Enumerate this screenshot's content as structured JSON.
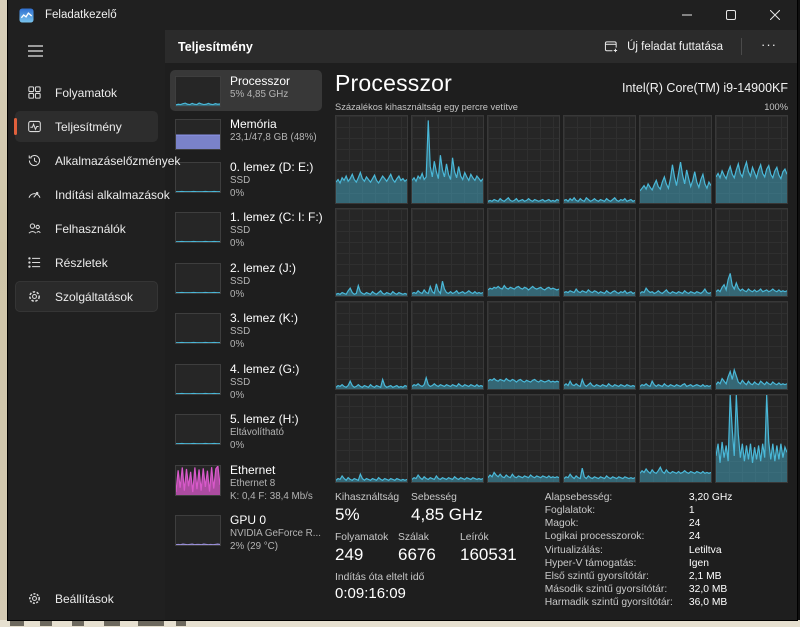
{
  "colors": {
    "accent": "#e0603c",
    "cpu": "#4ab8d8",
    "mem": "#8a93e6",
    "eth": "#d959cb",
    "gpu": "#9a8fd9",
    "desktop_sliver": "#d8cfba",
    "taskbar_sliver": "#e6e0d0"
  },
  "window": {
    "title": "Feladatkezelő"
  },
  "titlebar_icons": {
    "minimize": "minimize-icon",
    "maximize": "maximize-icon",
    "close": "close-icon"
  },
  "header": {
    "title": "Teljesítmény",
    "run_new_task": "Új feladat futtatása",
    "more": "···"
  },
  "sidebar": {
    "items": [
      {
        "label": "Folyamatok",
        "icon": "processes-grid-icon"
      },
      {
        "label": "Teljesítmény",
        "icon": "performance-pulse-icon",
        "selected": true
      },
      {
        "label": "Alkalmazáselőzmények",
        "icon": "app-history-clock-icon"
      },
      {
        "label": "Indítási alkalmazások",
        "icon": "startup-gauge-icon"
      },
      {
        "label": "Felhasználók",
        "icon": "users-icon"
      },
      {
        "label": "Részletek",
        "icon": "details-list-icon"
      },
      {
        "label": "Szolgáltatások",
        "icon": "services-cog-icon"
      }
    ],
    "settings_label": "Beállítások"
  },
  "perf_list": [
    {
      "title": "Processzor",
      "line2": "5% 4,85 GHz"
    },
    {
      "title": "Memória",
      "line2": "23,1/47,8 GB (48%)"
    },
    {
      "title": "0. lemez (D: E:)",
      "line2": "SSD",
      "line3": "0%"
    },
    {
      "title": "1. lemez (C: I: F:)",
      "line2": "SSD",
      "line3": "0%"
    },
    {
      "title": "2. lemez (J:)",
      "line2": "SSD",
      "line3": "0%"
    },
    {
      "title": "3. lemez (K:)",
      "line2": "SSD",
      "line3": "0%"
    },
    {
      "title": "4. lemez (G:)",
      "line2": "SSD",
      "line3": "0%"
    },
    {
      "title": "5. lemez (H:)",
      "line2": "Eltávolítható",
      "line3": "0%"
    },
    {
      "title": "Ethernet",
      "line2": "Ethernet 8",
      "line3": "K: 0,4 F: 38,4 Mb/s"
    },
    {
      "title": "GPU 0",
      "line2": "NVIDIA GeForce R...",
      "line3": "2% (29 °C)"
    }
  ],
  "thumbs": {
    "cpu": [
      4,
      6,
      5,
      8,
      10,
      6,
      5,
      9,
      6,
      5,
      10,
      7,
      5,
      6,
      9,
      6,
      5,
      8,
      6,
      7
    ],
    "mem": [
      48,
      48,
      48,
      48
    ],
    "disk": [
      1,
      1,
      2,
      1,
      1,
      1,
      2,
      1,
      1,
      1,
      2,
      1,
      1,
      2,
      1,
      1
    ],
    "eth": [
      10,
      85,
      25,
      95,
      15,
      90,
      30,
      80,
      10,
      95,
      20,
      88,
      15,
      92,
      28,
      84,
      12,
      96,
      22,
      90,
      100,
      35
    ],
    "gpu": [
      1,
      2,
      1,
      3,
      2,
      1,
      2,
      3,
      1,
      2,
      2,
      1,
      3,
      2,
      1,
      2,
      1,
      2,
      3,
      2
    ]
  },
  "detail": {
    "title": "Processzor",
    "cpu_name": "Intel(R) Core(TM) i9-14900KF",
    "subtitle_left": "Százalékos kihasználtság egy percre vetítve",
    "subtitle_right": "100%",
    "usage_label": "Kihasználtság",
    "usage_value": "5%",
    "speed_label": "Sebesség",
    "speed_value": "4,85 GHz",
    "processes_label": "Folyamatok",
    "processes_value": "249",
    "threads_label": "Szálak",
    "threads_value": "6676",
    "handles_label": "Leírók",
    "handles_value": "160531",
    "uptime_label": "Indítás óta eltelt idő",
    "uptime_value": "0:09:16:09",
    "stats_right": [
      {
        "label": "Alapsebesség:",
        "value": "3,20 GHz"
      },
      {
        "label": "Foglalatok:",
        "value": "1"
      },
      {
        "label": "Magok:",
        "value": "24"
      },
      {
        "label": "Logikai processzorok:",
        "value": "24"
      },
      {
        "label": "Virtualizálás:",
        "value": "Letiltva"
      },
      {
        "label": "Hyper-V támogatás:",
        "value": "Igen"
      },
      {
        "label": "Első szintű gyorsítótár:",
        "value": "2,1 MB"
      },
      {
        "label": "Második szintű gyorsítótár:",
        "value": "32,0 MB"
      },
      {
        "label": "Harmadik szintű gyorsítótár:",
        "value": "36,0 MB"
      }
    ]
  },
  "chart_data": {
    "type": "area",
    "title": "Processzor",
    "subtitle": "Százalékos kihasználtság egy percre vetítve",
    "layout": "24 logical-processor mini graphs, 4 rows × 6 columns, 60 s window",
    "ylim": [
      0,
      100
    ],
    "ymax_label": "100%",
    "grid": true,
    "series": [
      {
        "name": "CPU 0",
        "values": [
          24,
          27,
          23,
          29,
          26,
          31,
          25,
          28,
          33,
          27,
          24,
          29,
          35,
          28,
          25,
          30,
          27,
          24,
          28,
          32,
          26,
          23,
          27,
          31,
          28,
          25,
          29,
          33,
          27,
          24,
          28,
          31,
          26,
          28,
          25,
          27
        ]
      },
      {
        "name": "CPU 1",
        "values": [
          26,
          29,
          25,
          31,
          28,
          34,
          27,
          30,
          95,
          42,
          30,
          48,
          36,
          28,
          55,
          38,
          30,
          45,
          33,
          27,
          52,
          36,
          29,
          42,
          31,
          27,
          35,
          30,
          26,
          33,
          29,
          26,
          31,
          28,
          25,
          28
        ]
      },
      {
        "name": "CPU 2",
        "values": [
          2,
          3,
          2,
          4,
          3,
          2,
          5,
          3,
          2,
          4,
          6,
          3,
          2,
          3,
          5,
          2,
          3,
          4,
          2,
          3,
          5,
          3,
          2,
          4,
          3,
          2,
          3,
          4,
          2,
          3,
          4,
          2,
          3,
          2,
          4,
          3
        ]
      },
      {
        "name": "CPU 3",
        "values": [
          3,
          4,
          2,
          5,
          3,
          6,
          3,
          2,
          5,
          3,
          2,
          6,
          4,
          2,
          3,
          5,
          3,
          2,
          4,
          3,
          2,
          5,
          3,
          2,
          4,
          6,
          3,
          2,
          4,
          3,
          5,
          2,
          3,
          4,
          2,
          3
        ]
      },
      {
        "name": "CPU 4",
        "values": [
          14,
          17,
          20,
          16,
          22,
          18,
          15,
          21,
          26,
          19,
          16,
          24,
          30,
          22,
          17,
          28,
          44,
          30,
          20,
          34,
          47,
          32,
          22,
          38,
          28,
          19,
          26,
          36,
          24,
          18,
          27,
          33,
          22,
          17,
          24,
          20
        ]
      },
      {
        "name": "CPU 5",
        "values": [
          30,
          34,
          29,
          37,
          32,
          28,
          36,
          42,
          33,
          29,
          38,
          45,
          34,
          30,
          40,
          47,
          36,
          31,
          41,
          35,
          29,
          38,
          44,
          34,
          30,
          39,
          43,
          33,
          29,
          37,
          41,
          32,
          28,
          36,
          39,
          33
        ]
      },
      {
        "name": "CPU 6",
        "values": [
          2,
          3,
          2,
          4,
          3,
          2,
          6,
          9,
          4,
          2,
          3,
          12,
          5,
          3,
          2,
          4,
          3,
          2,
          5,
          3,
          2,
          4,
          6,
          3,
          2,
          4,
          3,
          2,
          5,
          3,
          2,
          4,
          3,
          2,
          3,
          2
        ]
      },
      {
        "name": "CPU 7",
        "values": [
          3,
          4,
          3,
          6,
          4,
          3,
          7,
          4,
          3,
          11,
          5,
          3,
          14,
          6,
          3,
          17,
          8,
          4,
          3,
          5,
          3,
          4,
          6,
          3,
          4,
          5,
          3,
          4,
          6,
          4,
          3,
          5,
          3,
          4,
          3,
          4
        ]
      },
      {
        "name": "CPU 8",
        "values": [
          7,
          9,
          8,
          10,
          9,
          11,
          9,
          8,
          12,
          9,
          8,
          10,
          9,
          8,
          10,
          11,
          9,
          8,
          10,
          9,
          7,
          9,
          11,
          9,
          8,
          9,
          10,
          8,
          7,
          9,
          10,
          8,
          9,
          8,
          7,
          8
        ]
      },
      {
        "name": "CPU 9",
        "values": [
          4,
          5,
          4,
          6,
          5,
          4,
          8,
          5,
          4,
          6,
          5,
          4,
          7,
          5,
          4,
          6,
          5,
          3,
          5,
          4,
          3,
          6,
          4,
          3,
          5,
          6,
          4,
          3,
          5,
          4,
          6,
          3,
          4,
          5,
          3,
          4
        ]
      },
      {
        "name": "CPU 10",
        "values": [
          3,
          5,
          4,
          9,
          6,
          4,
          5,
          3,
          4,
          6,
          4,
          3,
          5,
          7,
          4,
          3,
          5,
          4,
          3,
          5,
          4,
          3,
          6,
          4,
          3,
          5,
          4,
          3,
          5,
          4,
          3,
          5,
          8,
          4,
          3,
          4
        ]
      },
      {
        "name": "CPU 11",
        "values": [
          5,
          7,
          5,
          10,
          13,
          7,
          19,
          26,
          12,
          8,
          15,
          9,
          6,
          8,
          6,
          5,
          8,
          6,
          5,
          7,
          5,
          6,
          8,
          5,
          6,
          7,
          5,
          6,
          8,
          6,
          5,
          7,
          5,
          6,
          5,
          6
        ]
      },
      {
        "name": "CPU 12",
        "values": [
          2,
          4,
          3,
          5,
          3,
          2,
          4,
          9,
          4,
          2,
          3,
          5,
          3,
          2,
          4,
          3,
          2,
          5,
          3,
          2,
          4,
          3,
          2,
          11,
          4,
          2,
          3,
          4,
          2,
          3,
          4,
          2,
          3,
          2,
          4,
          3
        ]
      },
      {
        "name": "CPU 13",
        "values": [
          3,
          5,
          4,
          6,
          4,
          3,
          5,
          13,
          5,
          3,
          4,
          6,
          4,
          3,
          5,
          4,
          3,
          5,
          4,
          3,
          5,
          4,
          3,
          6,
          4,
          3,
          5,
          4,
          3,
          5,
          4,
          3,
          5,
          3,
          4,
          3
        ]
      },
      {
        "name": "CPU 14",
        "values": [
          9,
          11,
          10,
          12,
          10,
          9,
          11,
          10,
          9,
          12,
          10,
          9,
          11,
          10,
          8,
          10,
          11,
          9,
          8,
          10,
          9,
          8,
          10,
          11,
          9,
          8,
          10,
          9,
          8,
          9,
          10,
          8,
          9,
          8,
          9,
          8
        ]
      },
      {
        "name": "CPU 15",
        "values": [
          4,
          6,
          4,
          9,
          5,
          4,
          6,
          4,
          3,
          11,
          5,
          3,
          5,
          7,
          4,
          3,
          5,
          4,
          3,
          5,
          4,
          3,
          6,
          4,
          3,
          5,
          4,
          3,
          5,
          4,
          3,
          5,
          4,
          3,
          4,
          3
        ]
      },
      {
        "name": "CPU 16",
        "values": [
          3,
          5,
          4,
          6,
          4,
          3,
          9,
          5,
          3,
          5,
          4,
          3,
          6,
          4,
          3,
          5,
          4,
          3,
          5,
          4,
          3,
          5,
          6,
          3,
          4,
          5,
          3,
          4,
          5,
          4,
          3,
          5,
          3,
          4,
          3,
          4
        ]
      },
      {
        "name": "CPU 17",
        "values": [
          5,
          8,
          6,
          12,
          9,
          6,
          14,
          20,
          11,
          22,
          15,
          8,
          6,
          10,
          7,
          5,
          9,
          6,
          5,
          8,
          6,
          5,
          9,
          7,
          5,
          8,
          6,
          5,
          8,
          6,
          5,
          7,
          5,
          6,
          5,
          6
        ]
      },
      {
        "name": "CPU 18",
        "values": [
          2,
          4,
          3,
          7,
          4,
          2,
          5,
          3,
          2,
          4,
          3,
          2,
          9,
          4,
          2,
          4,
          3,
          2,
          4,
          3,
          2,
          5,
          3,
          2,
          4,
          3,
          2,
          4,
          3,
          2,
          4,
          3,
          2,
          3,
          2,
          3
        ]
      },
      {
        "name": "CPU 19",
        "values": [
          3,
          5,
          4,
          8,
          5,
          3,
          6,
          4,
          3,
          5,
          4,
          3,
          7,
          4,
          3,
          5,
          4,
          3,
          5,
          4,
          3,
          6,
          4,
          3,
          5,
          4,
          3,
          5,
          4,
          3,
          5,
          4,
          3,
          4,
          3,
          4
        ]
      },
      {
        "name": "CPU 20",
        "values": [
          5,
          8,
          6,
          11,
          8,
          6,
          9,
          6,
          5,
          8,
          6,
          5,
          9,
          6,
          5,
          7,
          6,
          5,
          7,
          6,
          5,
          8,
          6,
          5,
          7,
          6,
          5,
          7,
          6,
          5,
          7,
          5,
          6,
          5,
          6,
          5
        ]
      },
      {
        "name": "CPU 21",
        "values": [
          4,
          6,
          5,
          9,
          6,
          4,
          7,
          5,
          4,
          16,
          6,
          4,
          7,
          5,
          4,
          6,
          5,
          4,
          6,
          5,
          4,
          7,
          5,
          4,
          6,
          5,
          4,
          6,
          5,
          4,
          6,
          5,
          4,
          5,
          4,
          5
        ]
      },
      {
        "name": "CPU 22",
        "values": [
          10,
          13,
          11,
          15,
          12,
          10,
          14,
          11,
          10,
          13,
          17,
          12,
          10,
          14,
          11,
          10,
          12,
          11,
          10,
          12,
          10,
          11,
          13,
          11,
          10,
          12,
          11,
          10,
          12,
          11,
          10,
          12,
          10,
          11,
          10,
          11
        ]
      },
      {
        "name": "CPU 23",
        "values": [
          30,
          44,
          22,
          46,
          28,
          42,
          24,
          100,
          60,
          30,
          100,
          55,
          28,
          44,
          24,
          42,
          26,
          44,
          22,
          40,
          26,
          42,
          24,
          44,
          28,
          100,
          46,
          26,
          44,
          24,
          42,
          26,
          44,
          28,
          40,
          34
        ]
      }
    ]
  }
}
